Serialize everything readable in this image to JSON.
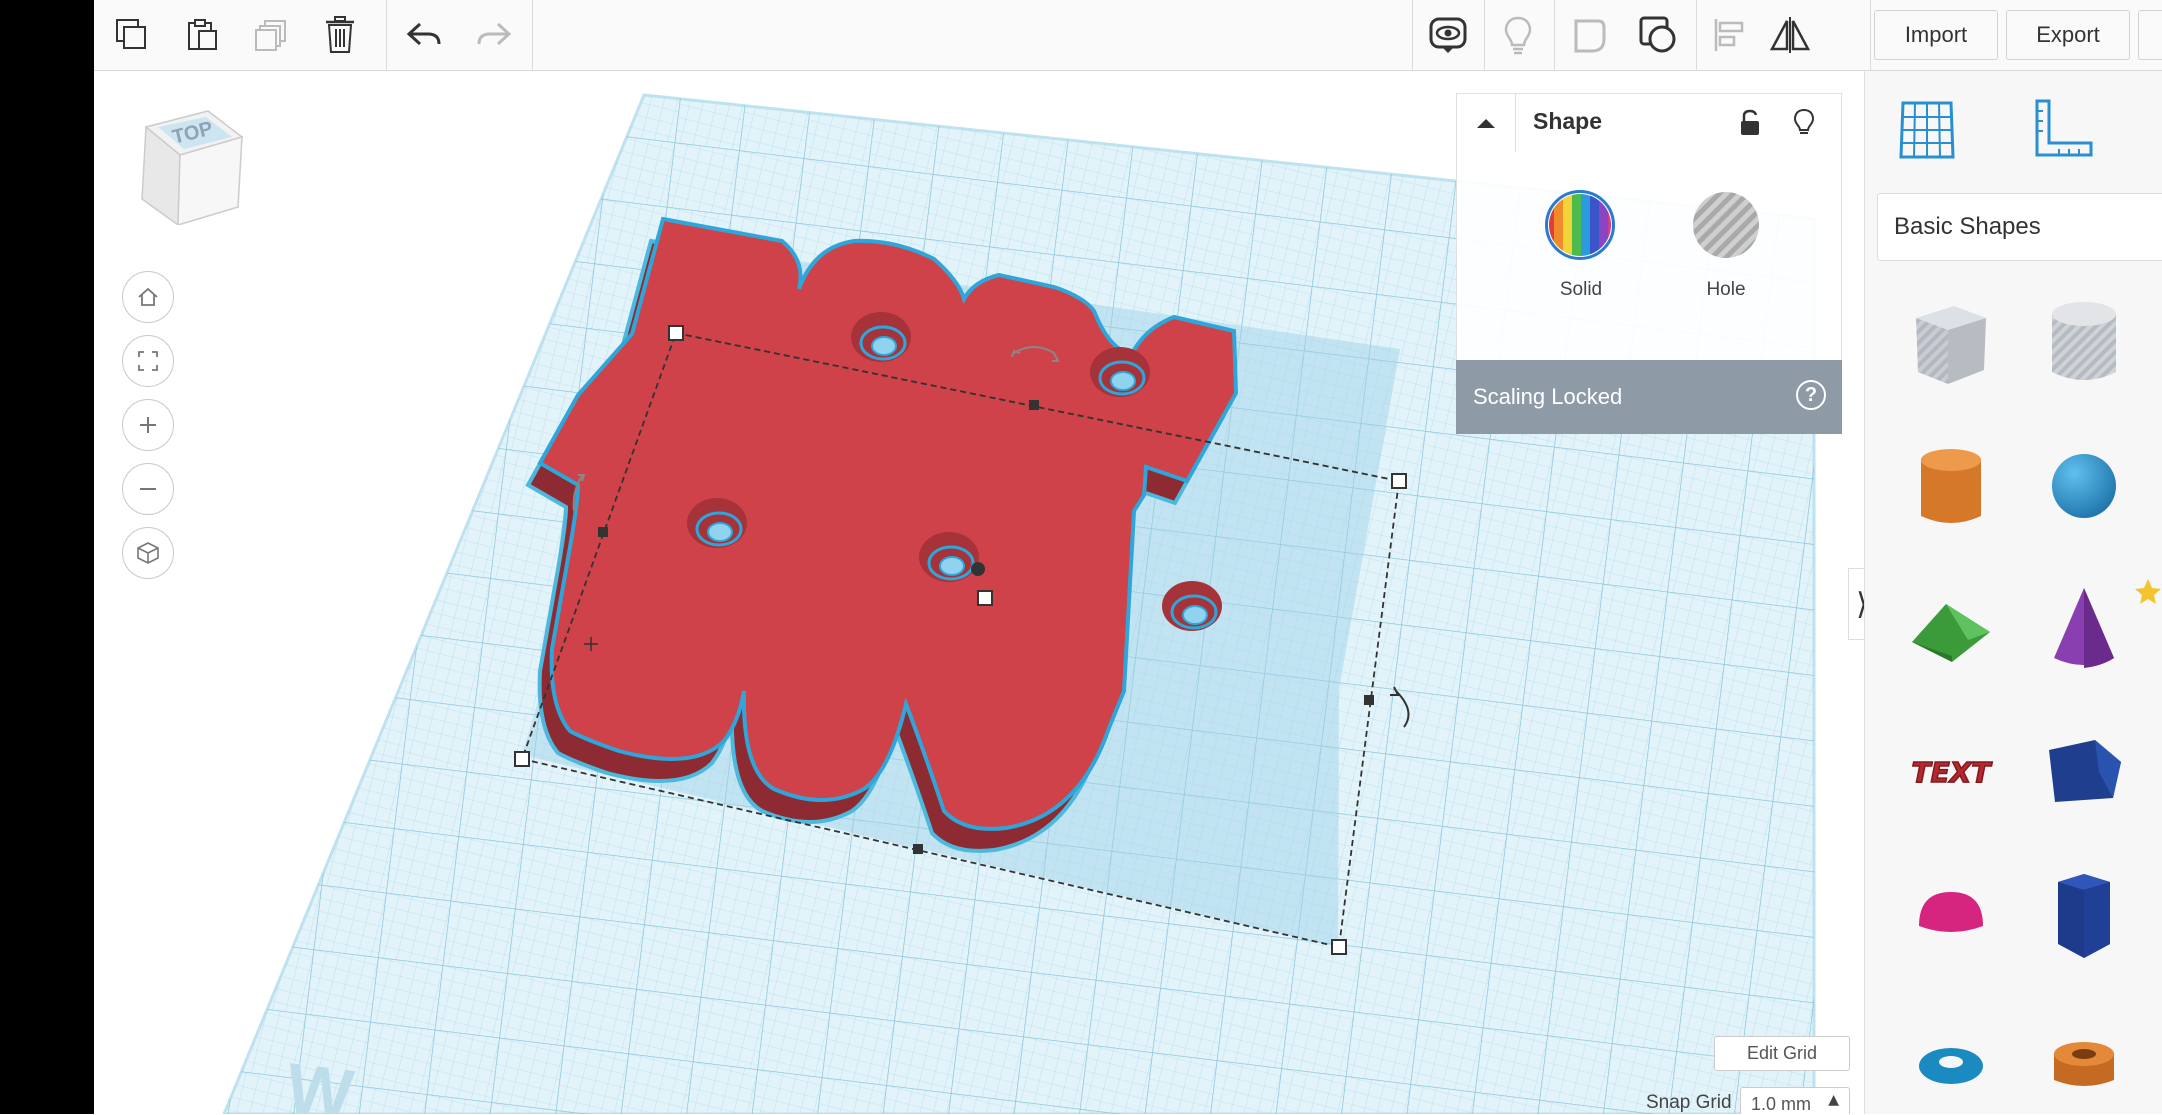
{
  "toolbar": {
    "left_tools": [
      "copy-icon",
      "paste-icon",
      "duplicate-icon",
      "delete-icon",
      "undo-icon",
      "redo-icon"
    ],
    "right_tools": [
      "show-all-icon",
      "lightbulb-icon",
      "group-icon",
      "ungroup-icon",
      "align-icon",
      "mirror-icon"
    ],
    "import_label": "Import",
    "export_label": "Export"
  },
  "view_cube": {
    "face_label": "TOP"
  },
  "navigation": [
    "home-view",
    "fit-all",
    "zoom-in",
    "zoom-out",
    "perspective"
  ],
  "inspector": {
    "title": "Shape",
    "solid_label": "Solid",
    "hole_label": "Hole",
    "scaling_text": "Scaling Locked",
    "help_glyph": "?"
  },
  "workplane": {
    "edit_grid_label": "Edit Grid",
    "snap_grid_label": "Snap Grid",
    "snap_grid_value": "1.0 mm"
  },
  "library": {
    "category": "Basic Shapes",
    "shapes": [
      "box-hole",
      "cylinder-hole",
      "cylinder",
      "sphere",
      "roof",
      "cone",
      "text",
      "polygon",
      "half-sphere",
      "hexagonal-prism",
      "torus",
      "tube"
    ],
    "text_shape_label": "TEXT"
  },
  "colors": {
    "accent": "#2ea6d9",
    "shape_red": "#cf4249",
    "workplane": "#dff1f7"
  }
}
